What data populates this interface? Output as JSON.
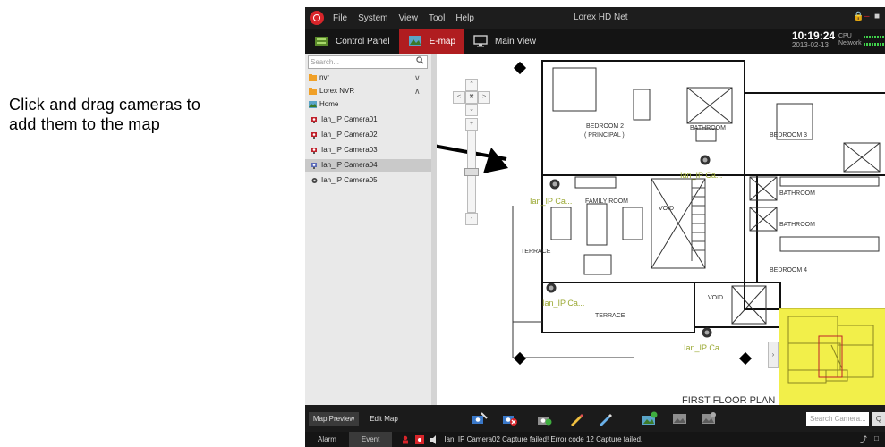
{
  "callout": {
    "text_line1": "Click and drag cameras to",
    "text_line2": "add them to the map"
  },
  "app": {
    "title": "Lorex HD Net",
    "menu": [
      "File",
      "System",
      "View",
      "Tool",
      "Help"
    ],
    "tabs": [
      {
        "label": "Control Panel",
        "icon": "control-panel-icon"
      },
      {
        "label": "E-map",
        "icon": "emap-icon",
        "active": true
      },
      {
        "label": "Main View",
        "icon": "monitor-icon"
      }
    ],
    "clock": {
      "time": "10:19:24",
      "date": "2013-02-13"
    },
    "stats": {
      "cpu_label": "CPU",
      "network_label": "Network"
    }
  },
  "sidebar": {
    "search_placeholder": "Search...",
    "tree": [
      {
        "label": "nvr",
        "icon": "folder-icon"
      },
      {
        "label": "Lorex NVR",
        "icon": "folder-icon"
      },
      {
        "label": "Home",
        "icon": "map-icon"
      },
      {
        "label": "Ian_IP Camera01",
        "icon": "camera-icon"
      },
      {
        "label": "Ian_IP Camera02",
        "icon": "camera-icon"
      },
      {
        "label": "Ian_IP Camera03",
        "icon": "camera-icon"
      },
      {
        "label": "Ian_IP Camera04",
        "icon": "camera-icon",
        "selected": true
      },
      {
        "label": "Ian_IP Camera05",
        "icon": "camera-icon"
      }
    ]
  },
  "map": {
    "camera_labels": [
      "Ian_IP Ca...",
      "Ian_IP Ca...",
      "Ian_IP Ca...",
      "Ian_IP Ca..."
    ],
    "room_labels": {
      "bedroom2": "BEDROOM 2",
      "principal": "( PRINCIPAL )",
      "bathroom1": "BATHROOM",
      "bedroom3": "BEDROOM 3",
      "family_room": "FAMILY ROOM",
      "void1": "VOID",
      "bathroom2": "BATHROOM",
      "bathroom3": "BATHROOM",
      "terrace1": "TERRACE",
      "bedroom4": "BEDROOM 4",
      "void2": "VOID",
      "terrace2": "TERRACE",
      "floor_plan": "FIRST FLOOR PLAN"
    },
    "accent": "#9aa832"
  },
  "bottom": {
    "map_preview": "Map Preview",
    "edit_map": "Edit Map",
    "search_camera_placeholder": "Search Camera...",
    "tools": [
      "add-camera-icon",
      "delete-camera-icon",
      "add-alarm-icon",
      "edit-icon",
      "modify-icon",
      "add-hotspot-icon",
      "map-link-icon",
      "remove-map-icon"
    ]
  },
  "status": {
    "alarm": "Alarm",
    "event": "Event",
    "message": "Ian_IP Camera02 Capture failed! Error code 12 Capture failed."
  },
  "colors": {
    "brand": "#d8252a",
    "active_tab": "#b01d20",
    "preview": "#f2ef4a"
  }
}
